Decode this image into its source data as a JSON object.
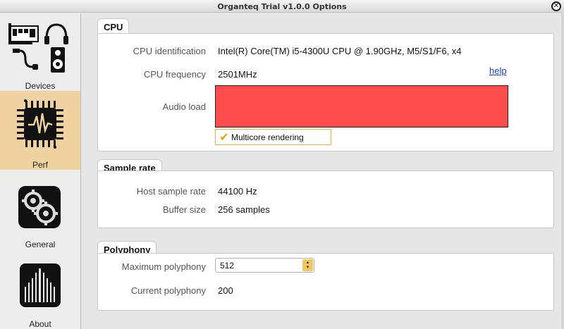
{
  "window": {
    "title": "Organteq Trial v1.0.0 Options"
  },
  "sidebar": {
    "items": [
      {
        "label": "Devices",
        "active": false
      },
      {
        "label": "Perf",
        "active": true
      },
      {
        "label": "General",
        "active": false
      },
      {
        "label": "About",
        "active": false
      }
    ]
  },
  "cpu": {
    "heading": "CPU",
    "identification_label": "CPU identification",
    "identification_value": "Intel(R) Core(TM) i5-4300U CPU @ 1.90GHz, M5/S1/F6, x4",
    "frequency_label": "CPU frequency",
    "frequency_value": "2501MHz",
    "help_label": "help",
    "audio_load_label": "Audio load",
    "audio_load_fraction": 1.0,
    "audio_load_color": "#ff4c4c",
    "multicore_label": "Multicore rendering",
    "multicore_checked": true
  },
  "sample_rate": {
    "heading": "Sample rate",
    "host_label": "Host sample rate",
    "host_value": "44100 Hz",
    "buffer_label": "Buffer size",
    "buffer_value": "256 samples"
  },
  "polyphony": {
    "heading": "Polyphony",
    "max_label": "Maximum polyphony",
    "max_value": "512",
    "current_label": "Current polyphony",
    "current_value": "200"
  },
  "colors": {
    "accent": "#f0d2a0",
    "checkbox": "#f0a000",
    "link": "#1a3fbf"
  }
}
